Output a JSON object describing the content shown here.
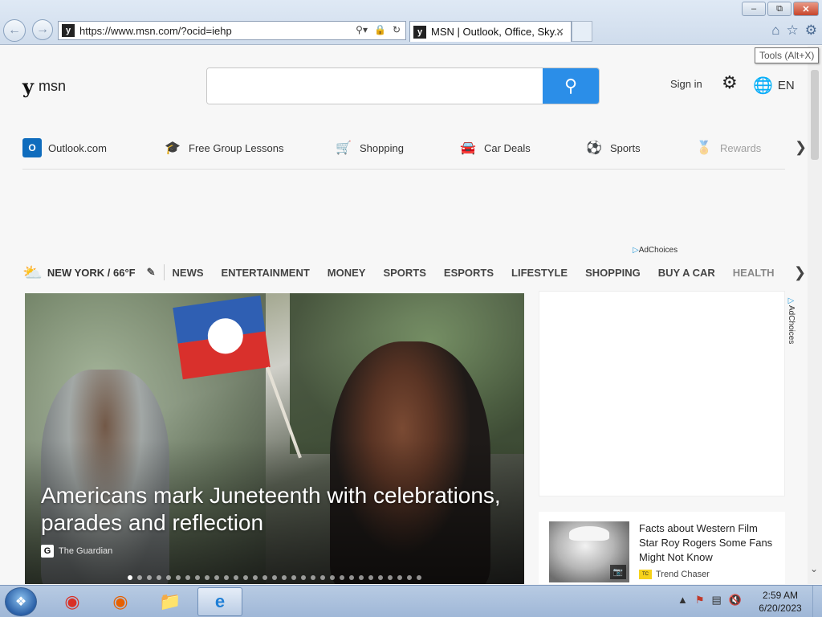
{
  "browser": {
    "url": "https://www.msn.com/?ocid=iehp",
    "tab_title": "MSN | Outlook, Office, Sky...",
    "tooltip": "Tools (Alt+X)",
    "window_buttons": {
      "minimize": "–",
      "restore": "⧉",
      "close": "✕"
    }
  },
  "header": {
    "logo_text": "msn",
    "search_placeholder": "",
    "signin_label": "Sign in",
    "language": "EN"
  },
  "quicklinks": [
    {
      "label": "Outlook.com",
      "icon": "outlook-icon",
      "color": "#0f6cbd"
    },
    {
      "label": "Free Group Lessons",
      "icon": "graduation-cap-icon",
      "color": "#6b2c9a"
    },
    {
      "label": "Shopping",
      "icon": "cart-icon",
      "color": "#1a72d4"
    },
    {
      "label": "Car Deals",
      "icon": "car-icon",
      "color": "#2b6fb8"
    },
    {
      "label": "Sports",
      "icon": "sports-ball-icon",
      "color": "#3b3f77"
    },
    {
      "label": "Rewards",
      "icon": "rewards-medal-icon",
      "color": "#f0b428"
    }
  ],
  "adchoices_label": "AdChoices",
  "navbar": {
    "weather": "NEW YORK / 66°F",
    "items": [
      "NEWS",
      "ENTERTAINMENT",
      "MONEY",
      "SPORTS",
      "ESPORTS",
      "LIFESTYLE",
      "SHOPPING",
      "BUY A CAR",
      "HEALTH"
    ]
  },
  "hero": {
    "title": "Americans mark Juneteenth with celebrations, parades and reflection",
    "source": "The Guardian",
    "dot_count": 31,
    "active_dot": 0
  },
  "card": {
    "title": "Facts about Western Film Star Roy Rogers Some Fans Might Not Know",
    "source": "Trend Chaser"
  },
  "taskbar": {
    "time": "2:59 AM",
    "date": "6/20/2023",
    "apps": [
      "chrome-icon",
      "firefox-icon",
      "file-explorer-icon",
      "internet-explorer-icon"
    ]
  }
}
